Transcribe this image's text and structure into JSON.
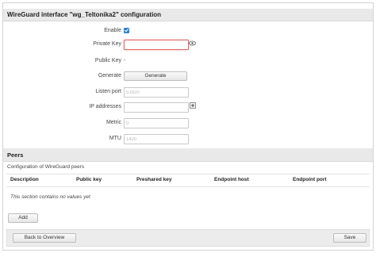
{
  "interface_section": {
    "title": "WireGuard interface \"wg_Teltonika2\" configuration",
    "fields": {
      "enable": {
        "label": "Enable",
        "checked": true
      },
      "private_key": {
        "label": "Private Key",
        "value": ""
      },
      "public_key": {
        "label": "Public Key",
        "value": "-"
      },
      "generate": {
        "label": "Generate",
        "button_label": "Generate"
      },
      "listen_port": {
        "label": "Listen port",
        "placeholder": "51820"
      },
      "ip_addresses": {
        "label": "IP addresses",
        "value": ""
      },
      "metric": {
        "label": "Metric",
        "placeholder": "0"
      },
      "mtu": {
        "label": "MTU",
        "placeholder": "1420"
      }
    }
  },
  "peers_section": {
    "title": "Peers",
    "description": "Configuration of WireGuard peers",
    "columns": [
      "Description",
      "Public key",
      "Preshared key",
      "Endpoint host",
      "Endpoint port"
    ],
    "empty_message": "This section contains no values yet",
    "add_label": "Add"
  },
  "footer": {
    "back_label": "Back to Overview",
    "save_label": "Save"
  },
  "icons": {
    "reveal": "eye-icon",
    "add_address": "add-entry-icon"
  },
  "colors": {
    "checkbox": "#2e7fd6",
    "focus_border": "#e06a6a"
  }
}
